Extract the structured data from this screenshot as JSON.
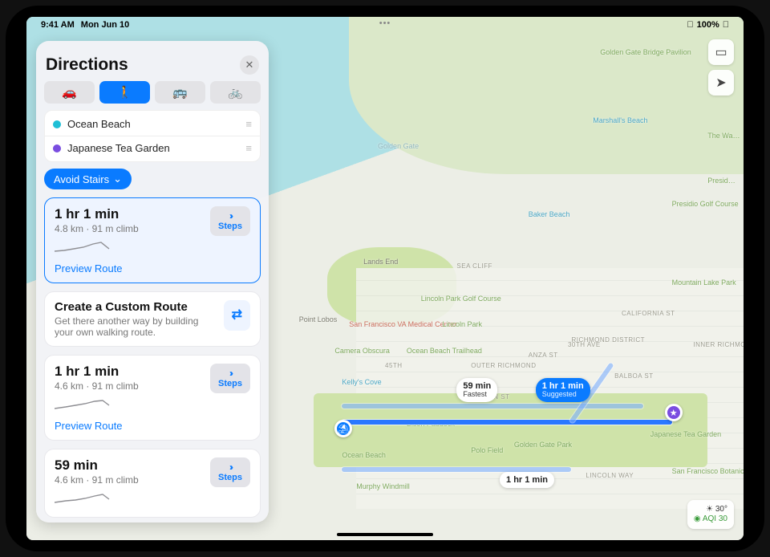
{
  "status": {
    "time": "9:41 AM",
    "date": "Mon Jun 10",
    "battery": "100%"
  },
  "panel": {
    "title": "Directions",
    "modes": {
      "car": "🚗",
      "walk": "🚶",
      "transit": "🚌",
      "cycle": "🚲"
    },
    "origin": "Ocean Beach",
    "destination": "Japanese Tea Garden",
    "avoid": "Avoid Stairs",
    "routes": [
      {
        "time": "1 hr 1 min",
        "sub": "4.8 km · 91 m climb",
        "preview": "Preview Route",
        "steps": "Steps"
      },
      {
        "time": "1 hr 1 min",
        "sub": "4.6 km · 91 m climb",
        "preview": "Preview Route",
        "steps": "Steps"
      },
      {
        "time": "59 min",
        "sub": "4.6 km · 91 m climb",
        "steps": "Steps"
      }
    ],
    "custom": {
      "title": "Create a Custom Route",
      "desc": "Get there another way by building your own walking route."
    }
  },
  "map": {
    "water_label": "Golden Gate",
    "labels": {
      "lands_end": "Lands End",
      "sea_cliff": "SEA CLIFF",
      "point_lobos": "Point Lobos",
      "camera_obscura": "Camera Obscura",
      "va": "San Francisco VA Medical Center",
      "lincoln_park": "Lincoln Park",
      "lincoln_golf": "Lincoln Park Golf Course",
      "richmond": "RICHMOND DISTRICT",
      "outer_richmond": "OUTER RICHMOND",
      "inner_richmond": "INNER RICHMOND",
      "california": "CALIFORNIA ST",
      "balboa": "BALBOA ST",
      "anza": "ANZA ST",
      "fulton": "FULTON ST",
      "lincoln_way": "LINCOLN WAY",
      "th30": "30TH AVE",
      "ocean_beach_th": "Ocean Beach Trailhead",
      "marshall": "Marshall's Beach",
      "baker": "Baker Beach",
      "kellys": "Kelly's Cove",
      "gg_bridge": "Golden Gate Bridge Pavilion",
      "presidio_golf": "Presidio Golf Course",
      "wa": "The Wa…",
      "presidio": "Presid…",
      "mountain_lake": "Mountain Lake Park",
      "sf_botanical": "San Francisco Botanical…",
      "gg_park": "Golden Gate Park",
      "polo": "Polo Field",
      "bison": "Bison Paddock",
      "murphy": "Murphy Windmill",
      "ocean_beach_p": "Ocean Beach",
      "tea_garden": "Japanese Tea Garden",
      "th45": "45TH"
    },
    "callouts": {
      "fastest": {
        "t": "59 min",
        "s": "Fastest"
      },
      "suggested": {
        "t": "1 hr 1 min",
        "s": "Suggested"
      },
      "alt": {
        "t": "1 hr 1 min"
      }
    },
    "weather": {
      "temp": "30°",
      "aqi": "AQI 30"
    }
  }
}
